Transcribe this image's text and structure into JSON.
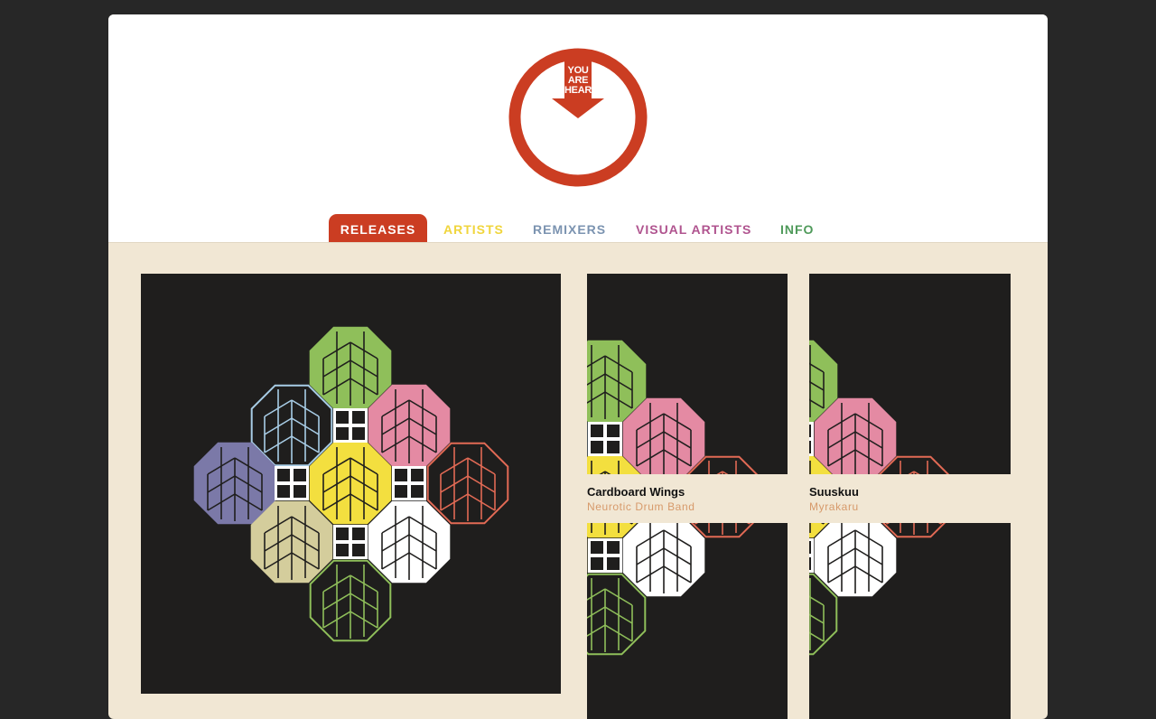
{
  "logo": {
    "lines": [
      "YOU",
      "ARE",
      "HEAR"
    ],
    "color": "#cb3d22"
  },
  "nav": {
    "tabs": [
      {
        "label": "RELEASES",
        "color": "#cb3d22",
        "active": true
      },
      {
        "label": "ARTISTS",
        "color": "#f0d53c",
        "active": false
      },
      {
        "label": "REMIXERS",
        "color": "#7b93b0",
        "active": false
      },
      {
        "label": "VISUAL ARTISTS",
        "color": "#b0548f",
        "active": false
      },
      {
        "label": "INFO",
        "color": "#4f9a5a",
        "active": false
      }
    ]
  },
  "releases": [
    {
      "title": "Cardboard Wings",
      "artist": "Neurotic Drum Band"
    },
    {
      "title": "Suuskuu",
      "artist": "Myrakaru"
    }
  ],
  "artwork": {
    "background": "#1f1e1d",
    "palette": {
      "green": "#8fbf5a",
      "lightblue": "#a8cde6",
      "pink": "#e48aa3",
      "purple": "#7b79a8",
      "yellow": "#f3df3f",
      "red": "#e26a55",
      "khaki": "#d4cd9c",
      "white": "#ffffff"
    }
  }
}
